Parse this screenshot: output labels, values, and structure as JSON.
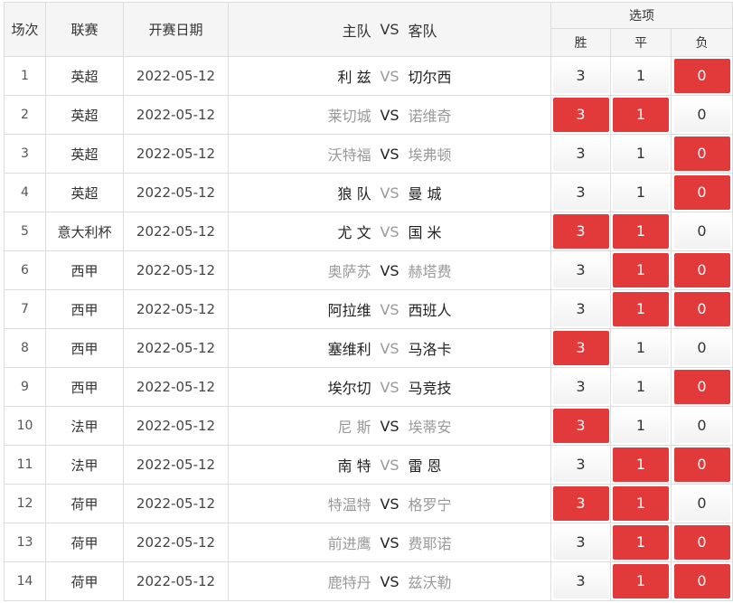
{
  "header": {
    "col_index": "场次",
    "col_league": "联赛",
    "col_date": "开赛日期",
    "col_home": "主队",
    "col_vs": "VS",
    "col_away": "客队",
    "col_options": "选项",
    "opt_win": "胜",
    "opt_draw": "平",
    "opt_lose": "负"
  },
  "colors": {
    "selected": "#e23a3a",
    "header_bg": "#f5f5f5",
    "dim_text": "#999999"
  },
  "rows": [
    {
      "no": "1",
      "league": "英超",
      "date": "2022-05-12",
      "home": "利 兹",
      "away": "切尔西",
      "vs": "VS",
      "bright": "home",
      "win": "3",
      "draw": "1",
      "lose": "0",
      "sel_win": false,
      "sel_draw": false,
      "sel_lose": true
    },
    {
      "no": "2",
      "league": "英超",
      "date": "2022-05-12",
      "home": "莱切城",
      "away": "诺维奇",
      "vs": "VS",
      "bright": "vs",
      "win": "3",
      "draw": "1",
      "lose": "0",
      "sel_win": true,
      "sel_draw": true,
      "sel_lose": false
    },
    {
      "no": "3",
      "league": "英超",
      "date": "2022-05-12",
      "home": "沃特福",
      "away": "埃弗顿",
      "vs": "VS",
      "bright": "vs",
      "win": "3",
      "draw": "1",
      "lose": "0",
      "sel_win": false,
      "sel_draw": false,
      "sel_lose": true
    },
    {
      "no": "4",
      "league": "英超",
      "date": "2022-05-12",
      "home": "狼 队",
      "away": "曼 城",
      "vs": "VS",
      "bright": "home",
      "win": "3",
      "draw": "1",
      "lose": "0",
      "sel_win": false,
      "sel_draw": false,
      "sel_lose": true
    },
    {
      "no": "5",
      "league": "意大利杯",
      "date": "2022-05-12",
      "home": "尤 文",
      "away": "国 米",
      "vs": "VS",
      "bright": "home",
      "win": "3",
      "draw": "1",
      "lose": "0",
      "sel_win": true,
      "sel_draw": true,
      "sel_lose": false
    },
    {
      "no": "6",
      "league": "西甲",
      "date": "2022-05-12",
      "home": "奥萨苏",
      "away": "赫塔费",
      "vs": "VS",
      "bright": "vs",
      "win": "3",
      "draw": "1",
      "lose": "0",
      "sel_win": false,
      "sel_draw": true,
      "sel_lose": true
    },
    {
      "no": "7",
      "league": "西甲",
      "date": "2022-05-12",
      "home": "阿拉维",
      "away": "西班人",
      "vs": "VS",
      "bright": "home",
      "win": "3",
      "draw": "1",
      "lose": "0",
      "sel_win": false,
      "sel_draw": true,
      "sel_lose": true
    },
    {
      "no": "8",
      "league": "西甲",
      "date": "2022-05-12",
      "home": "塞维利",
      "away": "马洛卡",
      "vs": "VS",
      "bright": "home",
      "win": "3",
      "draw": "1",
      "lose": "0",
      "sel_win": true,
      "sel_draw": false,
      "sel_lose": false
    },
    {
      "no": "9",
      "league": "西甲",
      "date": "2022-05-12",
      "home": "埃尔切",
      "away": "马竞技",
      "vs": "VS",
      "bright": "home",
      "win": "3",
      "draw": "1",
      "lose": "0",
      "sel_win": false,
      "sel_draw": false,
      "sel_lose": true
    },
    {
      "no": "10",
      "league": "法甲",
      "date": "2022-05-12",
      "home": "尼 斯",
      "away": "埃蒂安",
      "vs": "VS",
      "bright": "vs",
      "win": "3",
      "draw": "1",
      "lose": "0",
      "sel_win": true,
      "sel_draw": false,
      "sel_lose": false
    },
    {
      "no": "11",
      "league": "法甲",
      "date": "2022-05-12",
      "home": "南 特",
      "away": "雷 恩",
      "vs": "VS",
      "bright": "home",
      "win": "3",
      "draw": "1",
      "lose": "0",
      "sel_win": false,
      "sel_draw": true,
      "sel_lose": true
    },
    {
      "no": "12",
      "league": "荷甲",
      "date": "2022-05-12",
      "home": "特温特",
      "away": "格罗宁",
      "vs": "VS",
      "bright": "vs",
      "win": "3",
      "draw": "1",
      "lose": "0",
      "sel_win": true,
      "sel_draw": true,
      "sel_lose": false
    },
    {
      "no": "13",
      "league": "荷甲",
      "date": "2022-05-12",
      "home": "前进鹰",
      "away": "费耶诺",
      "vs": "VS",
      "bright": "vs",
      "win": "3",
      "draw": "1",
      "lose": "0",
      "sel_win": false,
      "sel_draw": true,
      "sel_lose": true
    },
    {
      "no": "14",
      "league": "荷甲",
      "date": "2022-05-12",
      "home": "鹿特丹",
      "away": "兹沃勒",
      "vs": "VS",
      "bright": "vs",
      "win": "3",
      "draw": "1",
      "lose": "0",
      "sel_win": false,
      "sel_draw": true,
      "sel_lose": true
    }
  ]
}
